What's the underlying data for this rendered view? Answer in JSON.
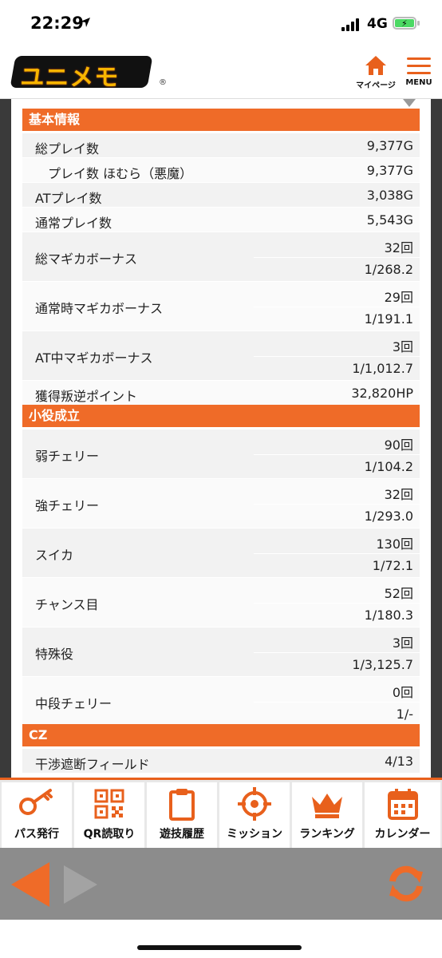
{
  "status_bar": {
    "time": "22:29",
    "network": "4G"
  },
  "header": {
    "logo_text": "ユニメモ",
    "mypage_label": "マイページ",
    "menu_label": "MENU"
  },
  "sections": {
    "basic": "基本情報",
    "small": "小役成立",
    "cz": "CZ"
  },
  "basic_rows": [
    {
      "label": "総プレイ数",
      "value": "9,377G"
    },
    {
      "label": "プレイ数 ほむら（悪魔）",
      "value": "9,377G"
    },
    {
      "label": "ATプレイ数",
      "value": "3,038G"
    },
    {
      "label": "通常プレイ数",
      "value": "5,543G"
    },
    {
      "label": "総マギカボーナス",
      "count": "32回",
      "prob": "1/268.2"
    },
    {
      "label": "通常時マギカボーナス",
      "count": "29回",
      "prob": "1/191.1"
    },
    {
      "label": "AT中マギカボーナス",
      "count": "3回",
      "prob": "1/1,012.7"
    },
    {
      "label": "獲得叛逆ポイント",
      "value": "32,820HP"
    }
  ],
  "small_rows": [
    {
      "label": "弱チェリー",
      "count": "90回",
      "prob": "1/104.2"
    },
    {
      "label": "強チェリー",
      "count": "32回",
      "prob": "1/293.0"
    },
    {
      "label": "スイカ",
      "count": "130回",
      "prob": "1/72.1"
    },
    {
      "label": "チャンス目",
      "count": "52回",
      "prob": "1/180.3"
    },
    {
      "label": "特殊役",
      "count": "3回",
      "prob": "1/3,125.7"
    },
    {
      "label": "中段チェリー",
      "count": "0回",
      "prob": "1/-"
    }
  ],
  "cz_rows": [
    {
      "label": "干渉遮断フィールド",
      "value": "4/13"
    }
  ],
  "tabs": [
    {
      "label": "パス発行",
      "icon": "key-icon"
    },
    {
      "label": "QR読取り",
      "icon": "qr-icon"
    },
    {
      "label": "遊技履歴",
      "icon": "clipboard-icon"
    },
    {
      "label": "ミッション",
      "icon": "target-icon"
    },
    {
      "label": "ランキング",
      "icon": "crown-icon"
    },
    {
      "label": "カレンダー",
      "icon": "calendar-icon"
    }
  ],
  "colors": {
    "accent": "#ef6b28"
  }
}
